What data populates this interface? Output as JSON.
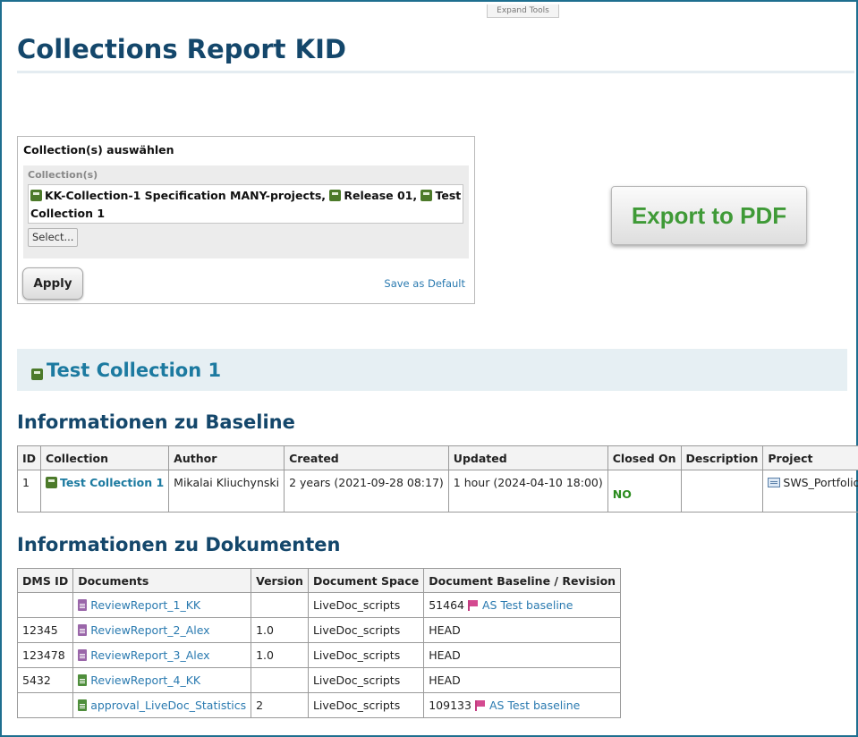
{
  "header": {
    "expand_tools": "Expand Tools",
    "title": "Collections Report KID"
  },
  "filter": {
    "title": "Collection(s) auswählen",
    "field_label": "Collection(s)",
    "selected": [
      "KK-Collection-1 Specification MANY-projects,",
      "Release 01,",
      "Test",
      "Collection 1"
    ],
    "select_button": "Select...",
    "apply_button": "Apply",
    "save_default": "Save as Default"
  },
  "export": {
    "label": "Export to PDF"
  },
  "collection": {
    "title": "Test Collection 1"
  },
  "baseline": {
    "section_title": "Informationen zu Baseline",
    "columns": [
      "ID",
      "Collection",
      "Author",
      "Created",
      "Updated",
      "Closed On",
      "Description",
      "Project"
    ],
    "row": {
      "id": "1",
      "collection": "Test Collection 1",
      "author": "Mikalai Kliuchynski",
      "created": "2 years (2021-09-28 08:17)",
      "updated": "1 hour (2024-04-10 18:00)",
      "closed_on": "NO",
      "description": "",
      "project": "SWS_Portfolio"
    }
  },
  "documents": {
    "section_title": "Informationen zu Dokumenten",
    "columns": [
      "DMS ID",
      "Documents",
      "Version",
      "Document Space",
      "Document Baseline / Revision"
    ],
    "rows": [
      {
        "dms_id": "",
        "name": "ReviewReport_1_KK",
        "icon": "purple",
        "version": "",
        "space": "LiveDoc_scripts",
        "revision": "51464",
        "baseline": "AS Test baseline"
      },
      {
        "dms_id": "12345",
        "name": "ReviewReport_2_Alex",
        "icon": "purple",
        "version": "1.0",
        "space": "LiveDoc_scripts",
        "revision": "HEAD",
        "baseline": ""
      },
      {
        "dms_id": "123478",
        "name": "ReviewReport_3_Alex",
        "icon": "purple",
        "version": "1.0",
        "space": "LiveDoc_scripts",
        "revision": "HEAD",
        "baseline": ""
      },
      {
        "dms_id": "5432",
        "name": "ReviewReport_4_KK",
        "icon": "green",
        "version": "",
        "space": "LiveDoc_scripts",
        "revision": "HEAD",
        "baseline": ""
      },
      {
        "dms_id": "",
        "name": "approval_LiveDoc_Statistics",
        "icon": "green",
        "version": "2",
        "space": "LiveDoc_scripts",
        "revision": "109133",
        "baseline": "AS Test baseline"
      }
    ]
  },
  "colors": {
    "frame": "#1e6f8f",
    "title": "#14476b",
    "link": "#2a7ab0",
    "export_text": "#3f9a37",
    "status_no": "#2b8c1e",
    "doc_purple": "#9a66a9",
    "doc_green": "#4f8e3c",
    "flag": "#d44a90"
  }
}
